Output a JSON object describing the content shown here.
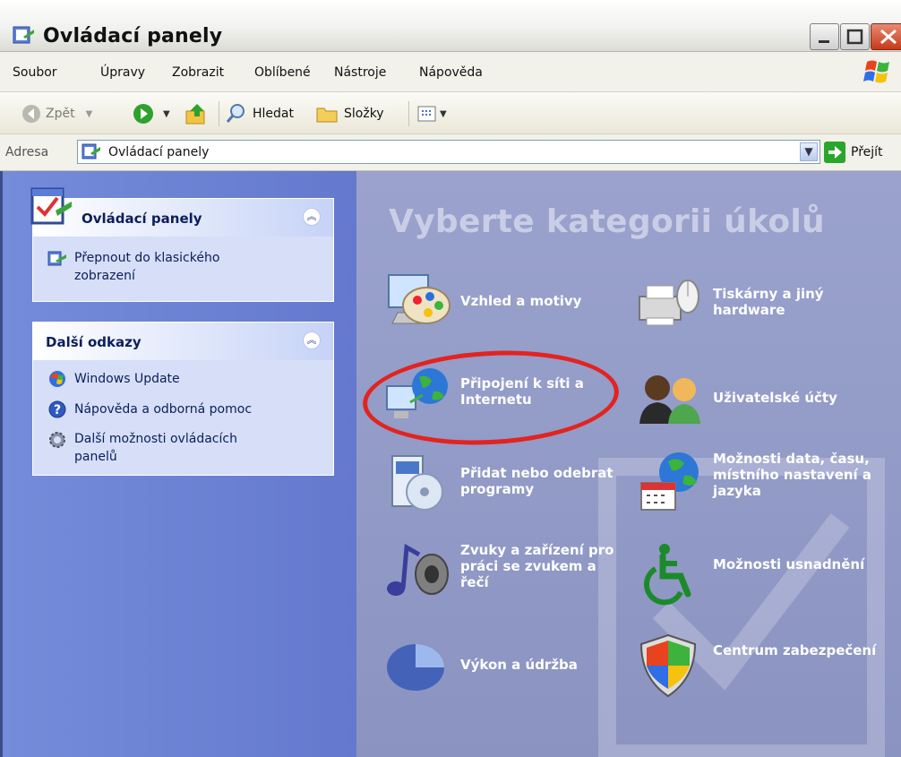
{
  "window": {
    "title": "Ovládací panely"
  },
  "menu": [
    "Soubor",
    "Úpravy",
    "Zobrazit",
    "Oblíbené",
    "Nástroje",
    "Nápověda"
  ],
  "toolbar": {
    "back": "Zpět",
    "search": "Hledat",
    "folders": "Složky"
  },
  "address": {
    "label": "Adresa",
    "value": "Ovládací panely",
    "go": "Přejít"
  },
  "sidebar": {
    "panel1": {
      "title": "Ovládací panely",
      "link": "Přepnout do klasického zobrazení"
    },
    "panel2": {
      "title": "Další odkazy",
      "links": [
        "Windows Update",
        "Nápověda a odborná pomoc",
        "Další možnosti ovládacích panelů"
      ]
    }
  },
  "main": {
    "heading": "Vyberte kategorii úkolů",
    "categories": [
      "Vzhled a motivy",
      "Tiskárny a jiný hardware",
      "Připojení k síti a Internetu",
      "Uživatelské účty",
      "Přidat nebo odebrat programy",
      "Možnosti data, času, místního nastavení a jazyka",
      "Zvuky a zařízení pro práci se zvukem a řečí",
      "Možnosti usnadnění",
      "Výkon a údržba",
      "Centrum zabezpečení"
    ]
  },
  "colors": {
    "highlight": "#e3231f",
    "sidebar": "#6c82d3",
    "main": "#8f97c4"
  }
}
